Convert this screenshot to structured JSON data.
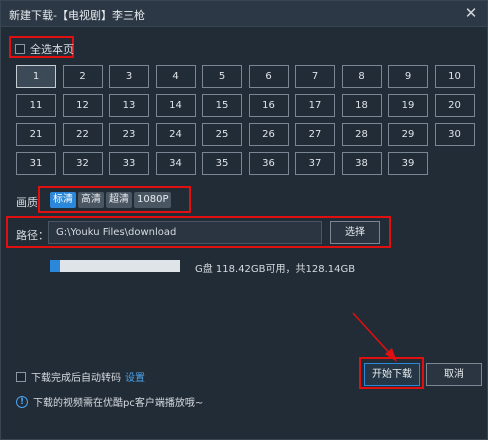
{
  "window": {
    "title": "新建下载-【电视剧】李三枪"
  },
  "select_all": {
    "label": "全选本页",
    "checked": false
  },
  "episodes": [
    "1",
    "2",
    "3",
    "4",
    "5",
    "6",
    "7",
    "8",
    "9",
    "10",
    "11",
    "12",
    "13",
    "14",
    "15",
    "16",
    "17",
    "18",
    "19",
    "20",
    "21",
    "22",
    "23",
    "24",
    "25",
    "26",
    "27",
    "28",
    "29",
    "30",
    "31",
    "32",
    "33",
    "34",
    "35",
    "36",
    "37",
    "38",
    "39"
  ],
  "selected_episode": "1",
  "quality": {
    "label": "画质",
    "options": [
      "标清",
      "高清",
      "超清",
      "1080P"
    ],
    "active": "标清"
  },
  "path": {
    "label": "路径：",
    "value": "G:\\Youku Files\\download",
    "browse_label": "选择"
  },
  "disk": {
    "text": "G盘 118.42GB可用，共128.14GB",
    "used_fraction": 0.076
  },
  "auto_transcode": {
    "label": "下载完成后自动转码",
    "checked": false
  },
  "settings_label": "设置",
  "start_label": "开始下载",
  "cancel_label": "取消",
  "info_text": "下载的视频需在优酷pc客户端播放哦~",
  "colors": {
    "accent": "#2b87d9",
    "highlight": "#e01010",
    "background": "#222c37"
  }
}
